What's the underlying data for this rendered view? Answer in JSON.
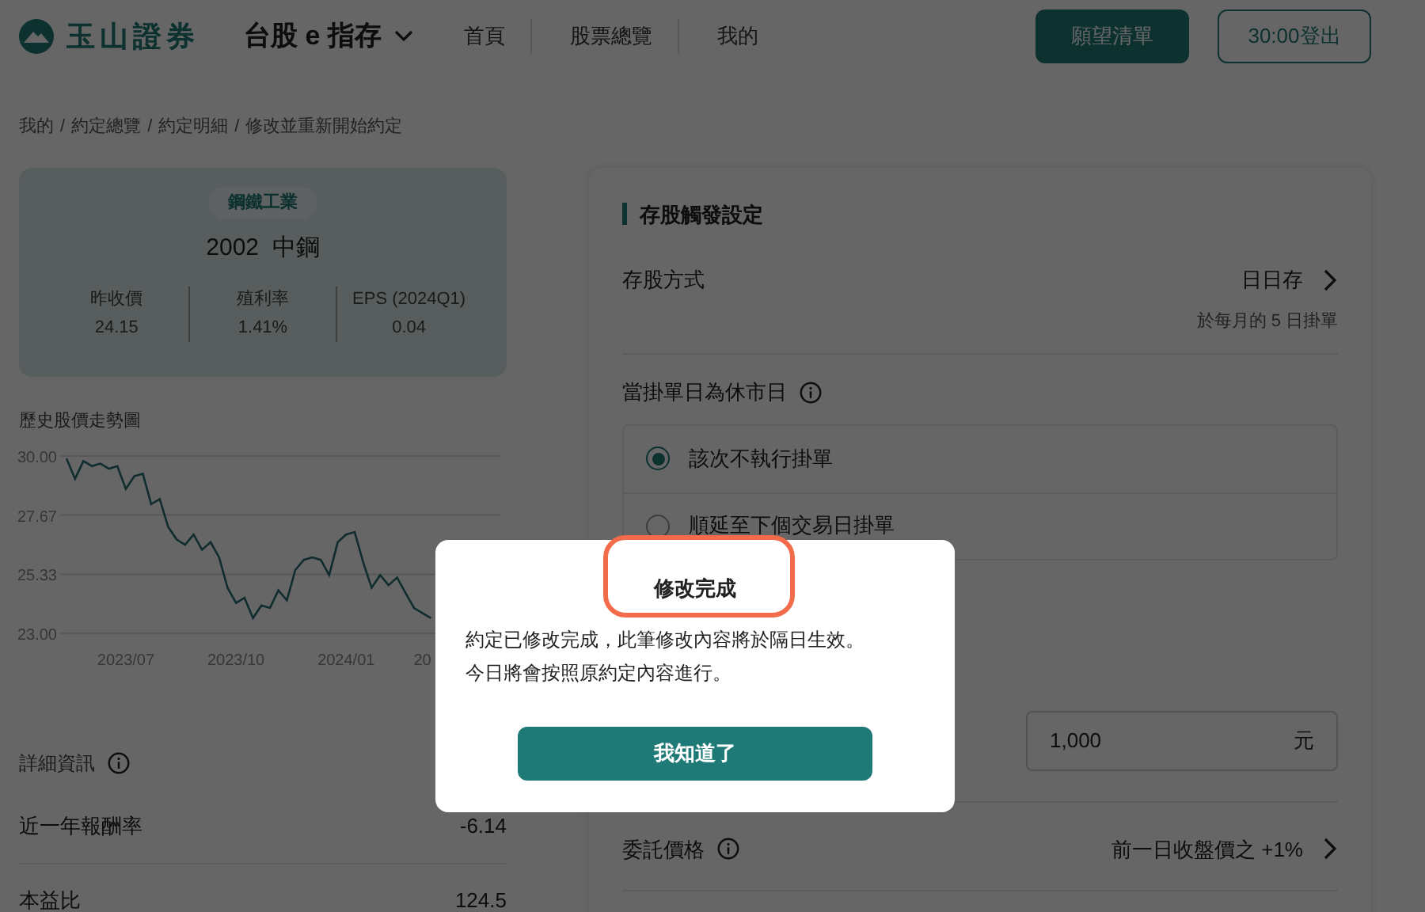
{
  "header": {
    "brand": "玉山證券",
    "product": "台股 e 指存",
    "nav": [
      {
        "label": "首頁"
      },
      {
        "label": "股票總覽"
      },
      {
        "label": "我的"
      }
    ],
    "buttons": [
      {
        "label": "願望清單",
        "kind": "primary"
      },
      {
        "label": "30:00登出",
        "kind": "outline"
      }
    ]
  },
  "breadcrumb": [
    "我的",
    "約定總覽",
    "約定明細",
    "修改並重新開始約定"
  ],
  "breadcrumb_separator": "/",
  "stock": {
    "industry": "鋼鐵工業",
    "code": "2002",
    "name": "中鋼",
    "stats": [
      {
        "label": "昨收價",
        "value": "24.15"
      },
      {
        "label": "殖利率",
        "value": "1.41%"
      },
      {
        "label": "EPS (2024Q1)",
        "value": "0.04"
      }
    ]
  },
  "history": {
    "title": "歷史股價走勢圖",
    "chart_data": {
      "type": "line",
      "categories": [
        null,
        null,
        null,
        null,
        null,
        null,
        null,
        "2023/07",
        null,
        null,
        null,
        null,
        null,
        null,
        null,
        null,
        null,
        null,
        null,
        null,
        "2023/10",
        null,
        null,
        null,
        null,
        null,
        null,
        null,
        null,
        null,
        null,
        null,
        null,
        "2024/01",
        null,
        null,
        null,
        null,
        null,
        null,
        null,
        null,
        "20",
        null
      ],
      "ylim": [
        23,
        30
      ],
      "yticks": [
        {
          "value": 30,
          "label": "30.00"
        },
        {
          "value": 27.67,
          "label": "27.67"
        },
        {
          "value": 25.33,
          "label": "25.33"
        },
        {
          "value": 23,
          "label": "23.00"
        }
      ],
      "series": [
        {
          "color": "#2a6f73",
          "values": [
            29.9,
            29.1,
            29.8,
            29.6,
            29.7,
            29.5,
            29.6,
            28.7,
            29.2,
            29.3,
            28.1,
            28.3,
            27.2,
            26.7,
            26.5,
            26.9,
            26.3,
            26.6,
            26.0,
            24.8,
            24.2,
            24.4,
            23.6,
            24.1,
            24.0,
            24.7,
            24.3,
            25.5,
            25.9,
            26.0,
            25.9,
            25.3,
            26.6,
            26.9,
            27.0,
            25.8,
            24.8,
            25.3,
            24.9,
            25.2,
            24.6,
            24.0,
            23.8,
            23.6
          ]
        }
      ]
    }
  },
  "details": {
    "title": "詳細資訊",
    "rows": [
      {
        "label": "近一年報酬率",
        "value": "-6.14"
      },
      {
        "label": "本益比",
        "value": "124.5"
      }
    ]
  },
  "settings": {
    "title": "存股觸發設定",
    "method": {
      "label": "存股方式",
      "value": "日日存",
      "note": "於每月的 5 日掛單"
    },
    "holiday": {
      "label": "當掛單日為休市日",
      "options": [
        {
          "label": "該次不執行掛單",
          "selected": true
        },
        {
          "label": "順延至下個交易日掛單",
          "selected": false
        }
      ]
    },
    "amount": {
      "value": "1,000",
      "unit": "元"
    },
    "price": {
      "label": "委託價格",
      "value": "前一日收盤價之 +1%"
    }
  },
  "dialog": {
    "title": "修改完成",
    "body": [
      "約定已修改完成，此筆修改內容將於隔日生效。",
      "今日將會按照原約定內容進行。"
    ],
    "button": "我知道了"
  }
}
